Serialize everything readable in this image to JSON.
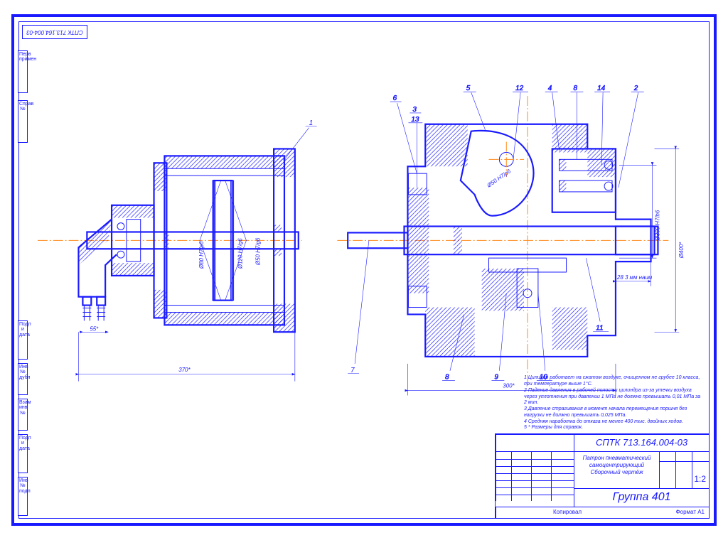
{
  "drawing_number": "СПТК 713.164.004-03",
  "drawing_number_tag": "СПТК 713.164.004-03",
  "title1": "Патрон пневматический",
  "title2": "самоцентрирующий",
  "title3": "Сборочный чертёж",
  "group": "Группа 401",
  "sheet_format": "Формат  А1",
  "copied_from": "Копировал",
  "scale_label": "1:2",
  "dim_left_overall": "370*",
  "dim_left_link": "55*",
  "dim_left_piston1": "Ø120 H7/g6",
  "dim_left_piston2": "Ø80 H7/p6",
  "dim_left_piston3": "Ø50 H7/g6",
  "dim_right_overall": "300*",
  "dim_right_diam_outer": "Ø400*",
  "dim_right_diam_inner": "Ø300 H7/h6",
  "dim_right_step": "28 3 мм наим",
  "dim_right_cam": "Ø50 H7/р6",
  "callouts_left": [
    "1"
  ],
  "callouts_right": [
    "2",
    "3",
    "4",
    "5",
    "6",
    "7",
    "8",
    "9",
    "10",
    "11",
    "12",
    "13",
    "14"
  ],
  "notes": [
    "1 Цилиндр работает на сжатом воздухе, очищенном не грубее 10 класса, при температуре выше 1°С.",
    "2 Падение давления в рабочей полости цилиндра из-за утечки воздуха через уплотнения при давлении 1 МПа не должно превышать 0,01 МПа за 2 мин.",
    "3 Давление страгивания в момент начала перемещения поршня без нагрузки не должно превышать 0,025 МПа.",
    "4 Средняя наработка до отказа не менее 400 тыс. двойных ходов.",
    "5 * Размеры для справок."
  ],
  "left_marks": [
    "Инв № подл",
    "Подп и дата",
    "Взам инв №",
    "Инв № дубл",
    "Подп и дата",
    "Справ №",
    "Перв примен"
  ]
}
